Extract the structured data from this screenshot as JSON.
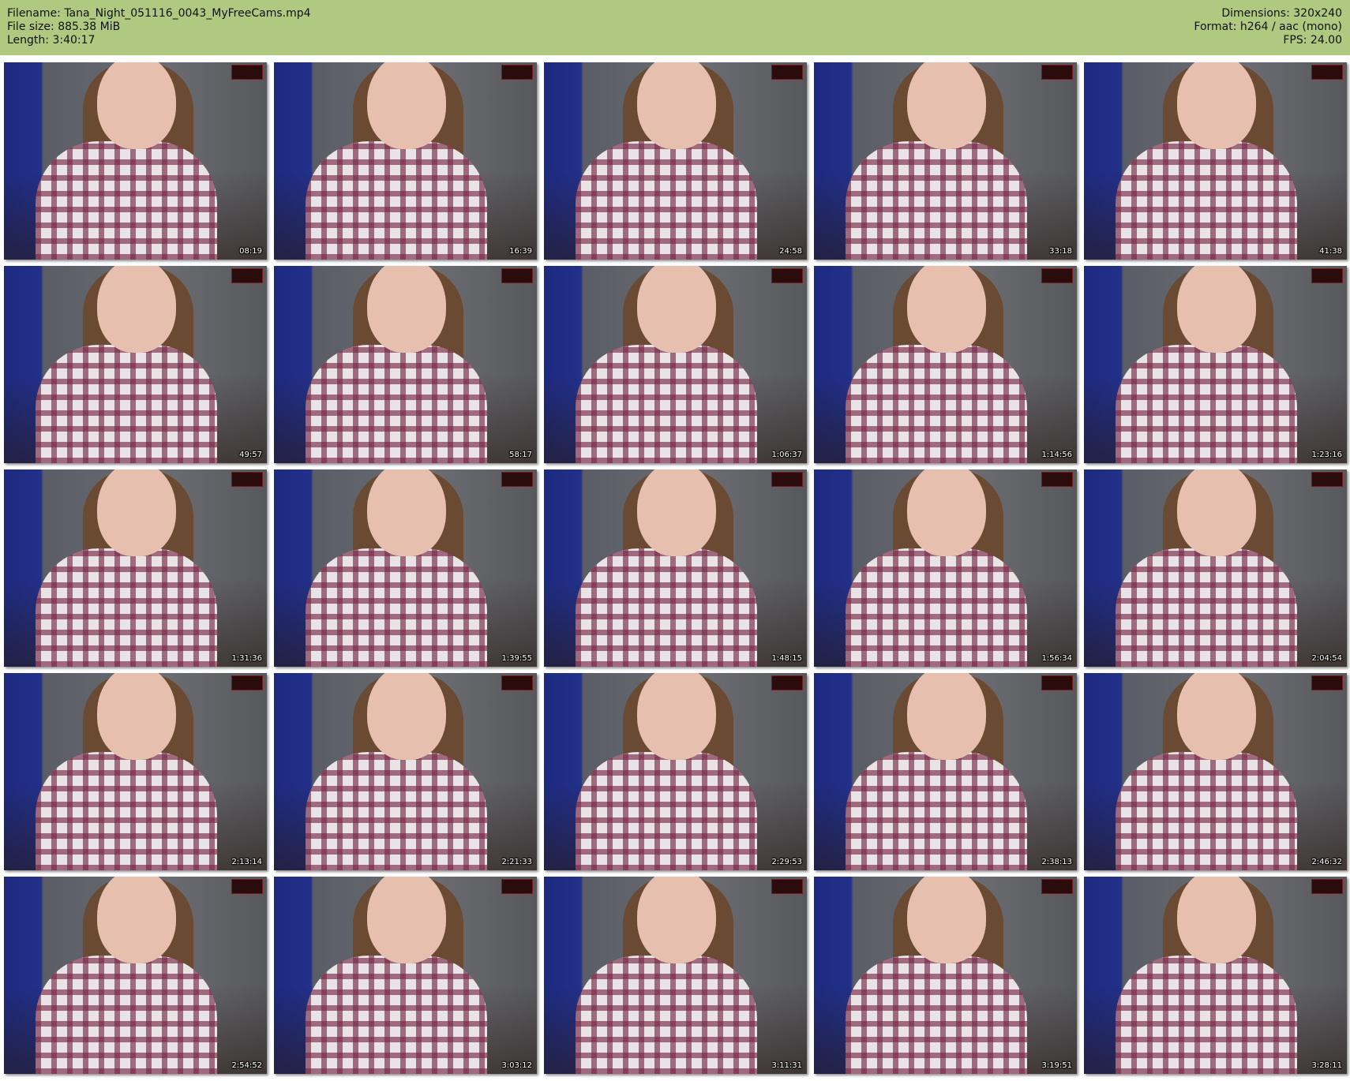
{
  "header": {
    "filename_label": "Filename:",
    "filename": "Tana_Night_051116_0043_MyFreeCams.mp4",
    "filesize_label": "File size:",
    "filesize": "885.38 MiB",
    "length_label": "Length:",
    "length": "3:40:17",
    "dimensions_label": "Dimensions:",
    "dimensions": "320x240",
    "format_label": "Format:",
    "format": "h264 / aac (mono)",
    "fps_label": "FPS:",
    "fps": "24.00"
  },
  "thumbnails": [
    {
      "time": "08:19"
    },
    {
      "time": "16:39"
    },
    {
      "time": "24:58"
    },
    {
      "time": "33:18"
    },
    {
      "time": "41:38"
    },
    {
      "time": "49:57"
    },
    {
      "time": "58:17"
    },
    {
      "time": "1:06:37"
    },
    {
      "time": "1:14:56"
    },
    {
      "time": "1:23:16"
    },
    {
      "time": "1:31:36"
    },
    {
      "time": "1:39:55"
    },
    {
      "time": "1:48:15"
    },
    {
      "time": "1:56:34"
    },
    {
      "time": "2:04:54"
    },
    {
      "time": "2:13:14"
    },
    {
      "time": "2:21:33"
    },
    {
      "time": "2:29:53"
    },
    {
      "time": "2:38:13"
    },
    {
      "time": "2:46:32"
    },
    {
      "time": "2:54:52"
    },
    {
      "time": "3:03:12"
    },
    {
      "time": "3:11:31"
    },
    {
      "time": "3:19:51"
    },
    {
      "time": "3:28:11"
    }
  ],
  "colors": {
    "header_bg": "#afca80",
    "page_bg": "#ffffff"
  }
}
